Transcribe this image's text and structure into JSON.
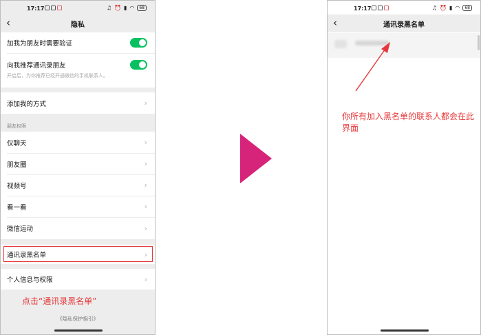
{
  "left_screen": {
    "status": {
      "time": "17:17",
      "battery": "68"
    },
    "nav": {
      "back": "‹",
      "title": "隐私"
    },
    "toggles": [
      {
        "label": "加我为朋友时需要验证",
        "on": true
      },
      {
        "label": "向我推荐通讯录朋友",
        "on": true,
        "subtext": "开启后，为你推荐已经开通微信的手机联系人。"
      }
    ],
    "add_me": "添加我的方式",
    "friend_perm_header": "朋友权限",
    "friend_perm_items": [
      "仅聊天",
      "朋友圈",
      "视频号",
      "看一看",
      "微信运动"
    ],
    "blacklist": "通讯录黑名单",
    "personal_info": "个人信息与权限",
    "annotation": "点击“通讯录黑名单”",
    "footer": "《隐私保护指引》"
  },
  "right_screen": {
    "status": {
      "time": "17:17",
      "battery": "68"
    },
    "nav": {
      "back": "‹",
      "title": "通讯录黑名单"
    },
    "annotation": "你所有加入黑名单的联系人都会在此界面"
  },
  "colors": {
    "accent_green": "#07c160",
    "annotation_red": "#e5383b",
    "arrow_magenta": "#d6247a"
  }
}
